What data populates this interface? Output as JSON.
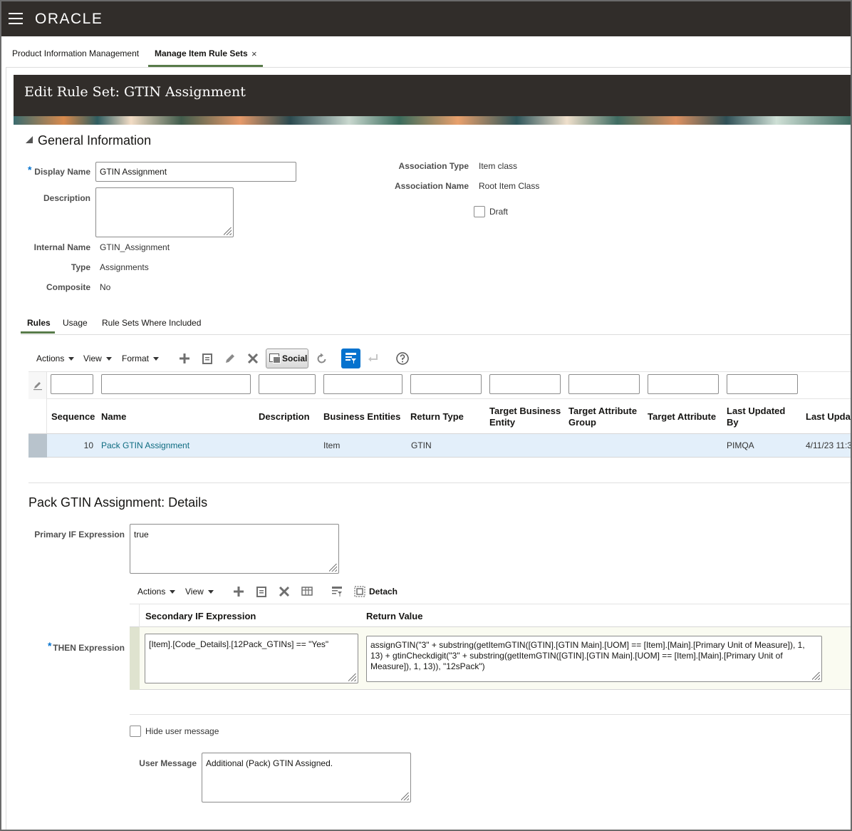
{
  "app": {
    "logo": "ORACLE"
  },
  "page_tabs": [
    {
      "label": "Product Information Management"
    },
    {
      "label": "Manage Item Rule Sets",
      "close": "×"
    }
  ],
  "header": {
    "title": "Edit Rule Set: GTIN Assignment"
  },
  "general": {
    "title": "General Information",
    "display_name_label": "Display Name",
    "display_name_value": "GTIN Assignment",
    "description_label": "Description",
    "description_value": "",
    "internal_name_label": "Internal Name",
    "internal_name_value": "GTIN_Assignment",
    "type_label": "Type",
    "type_value": "Assignments",
    "composite_label": "Composite",
    "composite_value": "No",
    "assoc_type_label": "Association Type",
    "assoc_type_value": "Item class",
    "assoc_name_label": "Association Name",
    "assoc_name_value": "Root Item Class",
    "draft_label": "Draft",
    "required_mark": "*"
  },
  "sub_tabs": [
    {
      "label": "Rules",
      "active": true
    },
    {
      "label": "Usage"
    },
    {
      "label": "Rule Sets Where Included"
    }
  ],
  "toolbar": {
    "actions": "Actions",
    "view": "View",
    "format": "Format",
    "social": "Social",
    "icons": [
      "add-icon",
      "duplicate-icon",
      "edit-icon",
      "delete-icon",
      "social-icon",
      "refresh-icon",
      "query-by-example-icon",
      "enter-icon",
      "help-icon"
    ]
  },
  "rules_table": {
    "columns": [
      "Sequence",
      "Name",
      "Description",
      "Business Entities",
      "Return Type",
      "Target Business Entity",
      "Target Attribute Group",
      "Target Attribute",
      "Last Updated By",
      "Last Upda"
    ],
    "rows": [
      {
        "sequence": "10",
        "name": "Pack GTIN Assignment",
        "description": "",
        "business_entities": "Item",
        "return_type": "GTIN",
        "target_business_entity": "",
        "target_attribute_group": "",
        "target_attribute": "",
        "last_updated_by": "PIMQA",
        "last_updated": "4/11/23 11:3"
      }
    ]
  },
  "details": {
    "title": "Pack GTIN Assignment: Details",
    "primary_if_label": "Primary IF Expression",
    "primary_if_value": "true",
    "toolbar": {
      "actions": "Actions",
      "view": "View",
      "detach": "Detach"
    },
    "grid_columns": [
      "Secondary IF Expression",
      "Return Value"
    ],
    "then_label": "THEN Expression",
    "secondary_if_value": "[Item].[Code_Details].[12Pack_GTINs] == \"Yes\"",
    "return_value": "assignGTIN(\"3\" + substring(getItemGTIN([GTIN].[GTIN Main].[UOM] == [Item].[Main].[Primary Unit of Measure]), 1, 13) + gtinCheckdigit(\"3\" + substring(getItemGTIN([GTIN].[GTIN Main].[UOM] == [Item].[Main].[Primary Unit of Measure]), 1, 13)), \"12sPack\")",
    "hide_user_message_label": "Hide user message",
    "user_message_label": "User Message",
    "user_message_value": "Additional (Pack) GTIN Assigned."
  },
  "colors": {
    "topbar": "#312d2a",
    "accent_tab": "#587b4a",
    "link": "#0d6b80",
    "required": "#0572ce",
    "selected_row": "#e3effa"
  }
}
